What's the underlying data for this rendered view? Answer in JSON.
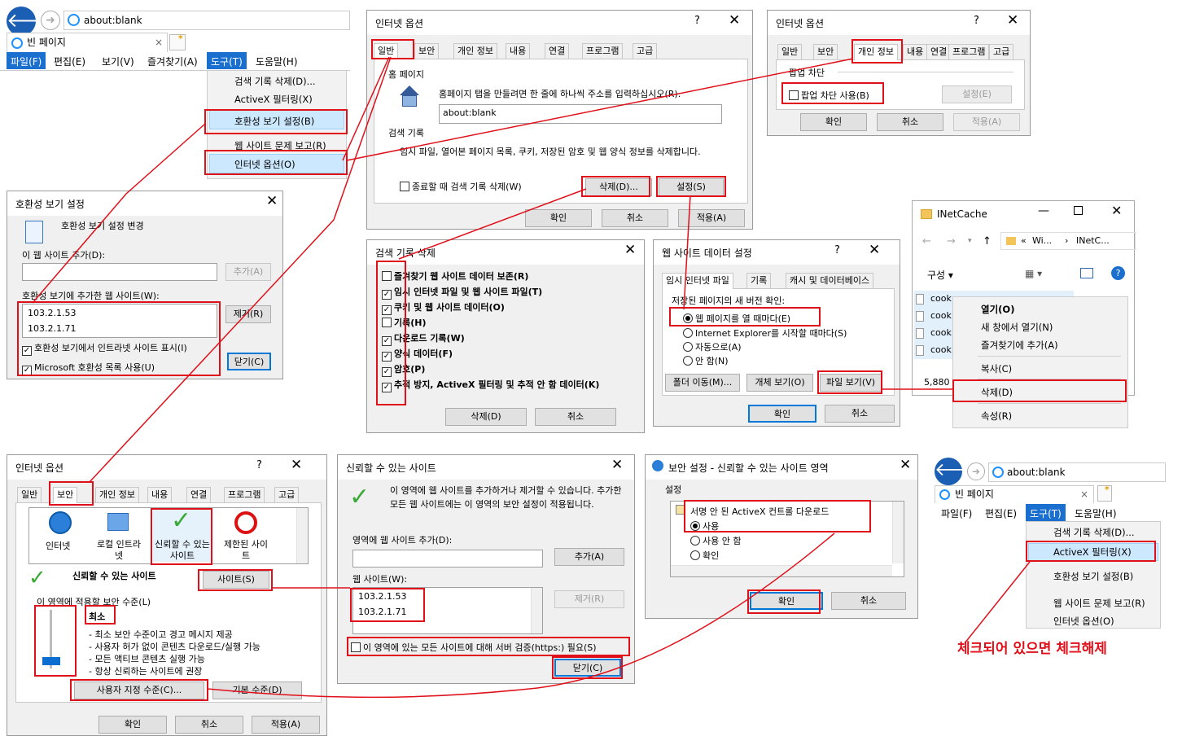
{
  "ie_top": {
    "address": "about:blank",
    "tab_title": "빈 페이지",
    "menus": [
      "파일(F)",
      "편집(E)",
      "보기(V)",
      "즐겨찾기(A)",
      "도구(T)",
      "도움말(H)"
    ],
    "tools_menu": [
      "검색 기록 삭제(D)...",
      "ActiveX 필터링(X)",
      "호환성 보기 설정(B)",
      "웹 사이트 문제 보고(R)",
      "인터넷 옵션(O)"
    ]
  },
  "ie_bottom": {
    "address": "about:blank",
    "tab_title": "빈 페이지",
    "menus": [
      "파일(F)",
      "편집(E)",
      "도구(T)",
      "도움말(H)"
    ],
    "tools_menu": [
      "검색 기록 삭제(D)...",
      "ActiveX 필터링(X)",
      "호환성 보기 설정(B)",
      "웹 사이트 문제 보고(R)",
      "인터넷 옵션(O)"
    ],
    "note": "체크되어 있으면 체크해제"
  },
  "inet_general": {
    "title": "인터넷 옵션",
    "help": "?",
    "tabs": [
      "일반",
      "보안",
      "개인 정보",
      "내용",
      "연결",
      "프로그램",
      "고급"
    ],
    "home_group": "홈 페이지",
    "home_desc": "홈페이지 탭을 만들려면 한 줄에 하나씩 주소를 입력하십시오(R).",
    "home_value": "about:blank",
    "history_group": "검색 기록",
    "history_desc": "임시 파일, 열어본 페이지 목록, 쿠키, 저장된 암호 및 웹 양식 정보를 삭제합니다.",
    "delete_on_exit": "종료할 때 검색 기록 삭제(W)",
    "btn_delete": "삭제(D)...",
    "btn_settings": "설정(S)",
    "btn_ok": "확인",
    "btn_cancel": "취소",
    "btn_apply": "적용(A)"
  },
  "inet_privacy": {
    "title": "인터넷 옵션",
    "help": "?",
    "tabs": [
      "일반",
      "보안",
      "개인 정보",
      "내용",
      "연결",
      "프로그램",
      "고급"
    ],
    "popup_group": "팝업 차단",
    "popup_check": "팝업 차단 사용(B)",
    "btn_settings": "설정(E)",
    "btn_ok": "확인",
    "btn_cancel": "취소",
    "btn_apply": "적용(A)"
  },
  "compat": {
    "title": "호환성 보기 설정",
    "header": "호환성 보기 설정 변경",
    "add_label": "이 웹 사이트 추가(D):",
    "btn_add": "추가(A)",
    "list_label": "호환성 보기에 추가한 웹 사이트(W):",
    "sites": [
      "103.2.1.53",
      "103.2.1.71"
    ],
    "btn_remove": "제거(R)",
    "intranet": "호환성 보기에서 인트라넷 사이트 표시(I)",
    "ms_list": "Microsoft 호환성 목록 사용(U)",
    "btn_close": "닫기(C)"
  },
  "delete_history": {
    "title": "검색 기록 삭제",
    "items": [
      {
        "label": "즐겨찾기 웹 사이트 데이터 보존(R)",
        "checked": false
      },
      {
        "label": "임시 인터넷 파일 및 웹 사이트 파일(T)",
        "checked": true
      },
      {
        "label": "쿠키 및 웹 사이트 데이터(O)",
        "checked": true
      },
      {
        "label": "기록(H)",
        "checked": false
      },
      {
        "label": "다운로드 기록(W)",
        "checked": true
      },
      {
        "label": "양식 데이터(F)",
        "checked": true
      },
      {
        "label": "암호(P)",
        "checked": true
      },
      {
        "label": "추적 방지, ActiveX 필터링 및 추적 안 함 데이터(K)",
        "checked": true
      }
    ],
    "btn_delete": "삭제(D)",
    "btn_cancel": "취소"
  },
  "site_data": {
    "title": "웹 사이트 데이터 설정",
    "help": "?",
    "tabs": [
      "임시 인터넷 파일",
      "기록",
      "캐시 및 데이터베이스"
    ],
    "check_label": "저장된 페이지의 새 버전 확인:",
    "options": [
      "웹 페이지를 열 때마다(E)",
      "Internet Explorer를 시작할 때마다(S)",
      "자동으로(A)",
      "안 함(N)"
    ],
    "btn_move": "폴더 이동(M)...",
    "btn_objects": "개체 보기(O)",
    "btn_files": "파일 보기(V)",
    "btn_ok": "확인",
    "btn_cancel": "취소"
  },
  "explorer": {
    "title": "INetCache",
    "path": [
      "Wi...",
      "INetC..."
    ],
    "organize": "구성",
    "files": [
      "cook",
      "cook",
      "cook",
      "cook"
    ],
    "size": "5,880",
    "context_menu": [
      "열기(O)",
      "새 창에서 열기(N)",
      "즐겨찾기에 추가(A)",
      "복사(C)",
      "삭제(D)",
      "속성(R)"
    ]
  },
  "inet_security": {
    "title": "인터넷 옵션",
    "help": "?",
    "tabs": [
      "일반",
      "보안",
      "개인 정보",
      "내용",
      "연결",
      "프로그램",
      "고급"
    ],
    "zones": [
      "인터넷",
      "로컬 인트라넷",
      "신뢰할 수 있는 사이트",
      "제한된 사이트"
    ],
    "zone_title": "신뢰할 수 있는 사이트",
    "btn_sites": "사이트(S)",
    "level_group": "이 영역에 적용할 보안 수준(L)",
    "level_name": "최소",
    "level_desc": [
      "- 최소 보안 수준이고 경고 메시지 제공",
      "- 사용자 허가 없이 콘텐츠 다운로드/실행 가능",
      "- 모든 액티브 콘텐츠 실행 가능",
      "- 항상 신뢰하는 사이트에 권장"
    ],
    "btn_custom": "사용자 지정 수준(C)...",
    "btn_default": "기본 수준(D)",
    "btn_ok": "확인",
    "btn_cancel": "취소",
    "btn_apply": "적용(A)"
  },
  "trusted_sites": {
    "title": "신뢰할 수 있는 사이트",
    "desc": "이 영역에 웹 사이트를 추가하거나 제거할 수 있습니다. 추가한 모든 웹 사이트에는 이 영역의 보안 설정이 적용됩니다.",
    "add_label": "영역에 웹 사이트 추가(D):",
    "btn_add": "추가(A)",
    "list_label": "웹 사이트(W):",
    "sites": [
      "103.2.1.53",
      "103.2.1.71"
    ],
    "btn_remove": "제거(R)",
    "https_check": "이 영역에 있는 모든 사이트에 대해 서버 검증(https:) 필요(S)",
    "btn_close": "닫기(C)"
  },
  "security_settings": {
    "title": "보안 설정 - 신뢰할 수 있는 사이트 영역",
    "group": "설정",
    "item": "서명 안 된 ActiveX 컨트롤 다운로드",
    "options": [
      "사용",
      "사용 안 함",
      "확인"
    ],
    "btn_ok": "확인",
    "btn_cancel": "취소"
  }
}
